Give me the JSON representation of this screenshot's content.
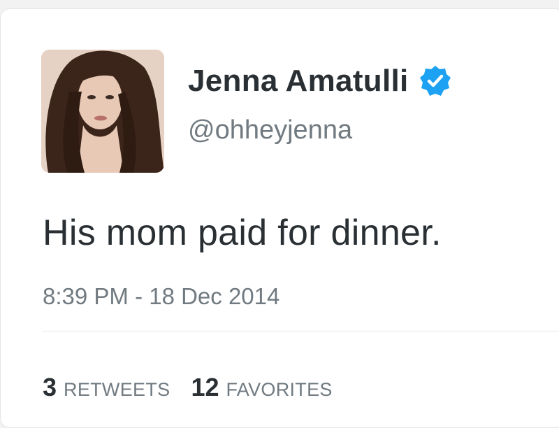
{
  "tweet": {
    "display_name": "Jenna Amatulli",
    "handle": "@ohheyjenna",
    "verified_icon": "verified-badge-icon",
    "text": "His mom paid for dinner.",
    "timestamp": "8:39 PM - 18 Dec 2014",
    "stats": {
      "retweets_count": "3",
      "retweets_label": "RETWEETS",
      "favorites_count": "12",
      "favorites_label": "FAVORITES"
    }
  },
  "colors": {
    "verified_blue": "#1da1f2",
    "name_text": "#292f33",
    "meta_text": "#707a80"
  }
}
